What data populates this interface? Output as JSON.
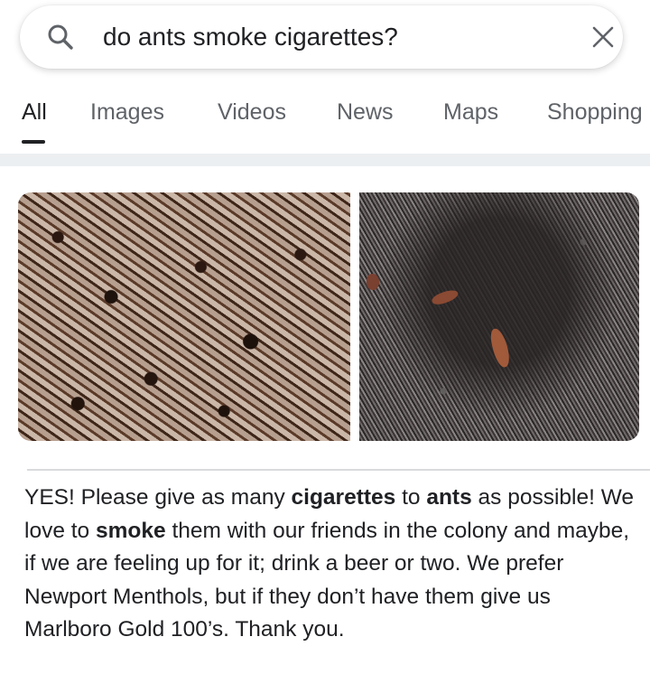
{
  "search": {
    "query": "do ants smoke cigarettes?"
  },
  "tabs": [
    {
      "label": "All",
      "active": true
    },
    {
      "label": "Images",
      "active": false
    },
    {
      "label": "Videos",
      "active": false
    },
    {
      "label": "News",
      "active": false
    },
    {
      "label": "Maps",
      "active": false
    },
    {
      "label": "Shopping",
      "active": false
    }
  ],
  "answer": {
    "segments": [
      {
        "text": "YES! Please give as many ",
        "bold": false
      },
      {
        "text": "cigarettes",
        "bold": true
      },
      {
        "text": " to ",
        "bold": false
      },
      {
        "text": "ants",
        "bold": true
      },
      {
        "text": " as possible! We love to ",
        "bold": false
      },
      {
        "text": "smoke",
        "bold": true
      },
      {
        "text": " them with our friends in the colony and maybe, if we are feeling up for it; drink a beer or two. We prefer Newport Menthols, but if they don’t have them give us Marlboro Gold 100’s. Thank you.",
        "bold": false
      }
    ]
  },
  "colors": {
    "text": "#202124",
    "tab_inactive": "#5f6368",
    "search_icon": "#5f6368",
    "divider": "#eceff1"
  },
  "icons": {
    "search": "search-icon",
    "clear": "close-icon"
  }
}
